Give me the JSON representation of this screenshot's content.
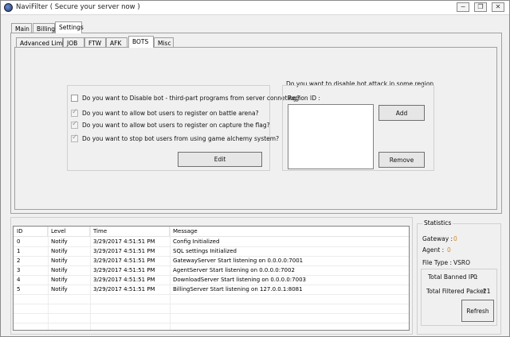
{
  "window": {
    "title": "NaviFilter ( Secure your server now )",
    "controls": {
      "minimize": "−",
      "restore": "❐",
      "close": "✕"
    }
  },
  "main_tabs": [
    "Main",
    "Billing",
    "Settings"
  ],
  "sub_tabs": [
    "Advanced Limits",
    "JOB",
    "FTW",
    "AFK",
    "BOTS",
    "Misc"
  ],
  "bots": {
    "options": [
      {
        "label": "Do you want to Disable bot - third-part programs from server conneting?",
        "checked": false
      },
      {
        "label": "Do you want to allow bot users to register on battle arena?",
        "checked": true
      },
      {
        "label": "Do you want to allow bot users to register on capture the flag?",
        "checked": true
      },
      {
        "label": "Do you want to stop bot users from using game alchemy system?",
        "checked": true
      }
    ],
    "edit_label": "Edit",
    "region": {
      "title": "Do you want to disable bot attack in some region",
      "list_label": "Region ID :",
      "add_label": "Add",
      "remove_label": "Remove"
    }
  },
  "log": {
    "columns": [
      "ID",
      "Level",
      "Time",
      "Message"
    ],
    "rows": [
      [
        "0",
        "Notify",
        "3/29/2017 4:51:51 PM",
        "Config Initialized"
      ],
      [
        "1",
        "Notify",
        "3/29/2017 4:51:51 PM",
        "SQL settings Initialized"
      ],
      [
        "2",
        "Notify",
        "3/29/2017 4:51:51 PM",
        "GatewayServer Start listening on  0.0.0.0:7001"
      ],
      [
        "3",
        "Notify",
        "3/29/2017 4:51:51 PM",
        "AgentServer Start listening on  0.0.0.0:7002"
      ],
      [
        "4",
        "Notify",
        "3/29/2017 4:51:51 PM",
        "DownloadServer Start listening on  0.0.0.0:7003"
      ],
      [
        "5",
        "Notify",
        "3/29/2017 4:51:51 PM",
        "BillingServer Start listening on 127.0.0.1:8081"
      ]
    ]
  },
  "statistics": {
    "title": "Statistics",
    "gateway_label": "Gateway :",
    "gateway_value": "0",
    "agent_label": "Agent :",
    "agent_value": "0",
    "filetype_label": "File Type :",
    "filetype_value": "VSRO",
    "banned_label": "Total Banned IP :",
    "banned_value": "0",
    "filtered_label": "Total Filtered Packet :",
    "filtered_value": "21",
    "refresh_label": "Refresh",
    "value_color": "#d08a2a"
  }
}
